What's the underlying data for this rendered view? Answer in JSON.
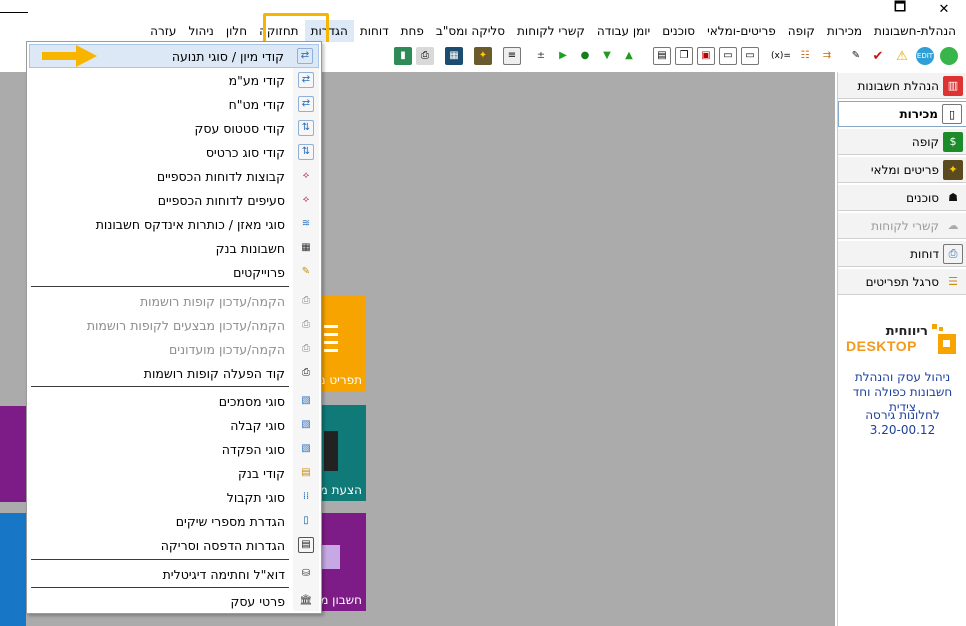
{
  "window": {
    "min_glyph": "🗖",
    "close_glyph": "✕"
  },
  "menubar": {
    "items": [
      {
        "label": "הנהלת-חשבונות"
      },
      {
        "label": "מכירות"
      },
      {
        "label": "קופה"
      },
      {
        "label": "פריטים-ומלאי"
      },
      {
        "label": "סוכנים"
      },
      {
        "label": "יומן עבודה"
      },
      {
        "label": "קשרי לקוחות"
      },
      {
        "label": "סליקה ומס\"ב"
      },
      {
        "label": "פחת"
      },
      {
        "label": "דוחות"
      },
      {
        "label": "הגדרות"
      },
      {
        "label": "תחזוקה"
      },
      {
        "label": "חלון"
      },
      {
        "label": "ניהול"
      },
      {
        "label": "עזרה"
      }
    ],
    "active": "הגדרות"
  },
  "toolbar": {
    "icons": [
      "exit-door-icon",
      "printer-icon",
      "calculator-icon",
      "tools-box-icon",
      "notepad-icon",
      "plus-minus-icon",
      "forward-icon",
      "money-bag-icon",
      "download-green-icon",
      "upload-green-icon",
      "documents-icon",
      "copy-icon",
      "report-icon",
      "card-icon",
      "card2-icon",
      "formula-icon",
      "stack-icon",
      "transfer-icon",
      "edit-pen-icon",
      "check-red-icon",
      "warning-icon",
      "edit-round-icon",
      "green-circle-icon"
    ],
    "formula_text": "(x)="
  },
  "dropdown": {
    "items": [
      {
        "label": "קודי מיון / סוגי תנועה",
        "disabled": false,
        "icon": "sort-codes-icon"
      },
      {
        "label": "קודי מע\"מ",
        "disabled": false,
        "icon": "vat-codes-icon"
      },
      {
        "label": "קודי מט\"ח",
        "disabled": false,
        "icon": "currency-codes-icon"
      },
      {
        "label": "קודי סטטוס עסק",
        "disabled": false,
        "icon": "business-status-icon"
      },
      {
        "label": "קודי סוג כרטיס",
        "disabled": false,
        "icon": "card-type-icon"
      },
      {
        "label": "קבוצות לדוחות הכספיים",
        "disabled": false,
        "icon": "report-groups-icon"
      },
      {
        "label": "סעיפים לדוחות הכספיים",
        "disabled": false,
        "icon": "report-sections-icon"
      },
      {
        "label": "סוגי מאזן / כותרות אינדקס חשבונות",
        "disabled": false,
        "icon": "balance-types-icon"
      },
      {
        "label": "חשבונות בנק",
        "disabled": false,
        "icon": "bank-accounts-icon"
      },
      {
        "label": "פרוייקטים",
        "disabled": false,
        "icon": "projects-icon"
      },
      {
        "label": "הקמה/עדכון קופות רושמות",
        "disabled": true,
        "icon": "cash-register-icon"
      },
      {
        "label": "הקמה/עדכון מבצעים לקופות רושמות",
        "disabled": true,
        "icon": "cash-register-promo-icon"
      },
      {
        "label": "הקמה/עדכון מועדונים",
        "disabled": true,
        "icon": "clubs-icon"
      },
      {
        "label": "קוד הפעלה קופות רושמות",
        "disabled": false,
        "icon": "register-activation-icon"
      },
      {
        "label": "סוגי מסמכים",
        "disabled": false,
        "icon": "document-types-icon"
      },
      {
        "label": "סוגי קבלה",
        "disabled": false,
        "icon": "receipt-types-icon"
      },
      {
        "label": "סוגי הפקדה",
        "disabled": false,
        "icon": "deposit-types-icon"
      },
      {
        "label": "קודי בנק",
        "disabled": false,
        "icon": "bank-codes-icon"
      },
      {
        "label": "סוגי תקבול",
        "disabled": false,
        "icon": "payment-types-icon"
      },
      {
        "label": "הגדרת מספרי שיקים",
        "disabled": false,
        "icon": "check-numbers-icon"
      },
      {
        "label": "הגדרות הדפסה וסריקה",
        "disabled": false,
        "icon": "print-scan-icon"
      },
      {
        "label": "דוא\"ל וחתימה דיגיטלית",
        "disabled": false,
        "icon": "email-signature-icon"
      },
      {
        "label": "פרטי עסק",
        "disabled": false,
        "icon": "business-details-icon"
      }
    ]
  },
  "tiles": [
    {
      "label": "תפריט מ",
      "color": "#f7a400"
    },
    {
      "label": "הצעת מ",
      "color": "#0f7a78"
    },
    {
      "label": "חשבון מ",
      "color": "#7d1c86"
    }
  ],
  "sidebar": {
    "items": [
      {
        "label": "הנהלת חשבונות",
        "state": "normal",
        "icon": "ledger-book-icon"
      },
      {
        "label": "מכירות",
        "state": "selected",
        "icon": "sales-document-icon"
      },
      {
        "label": "קופה",
        "state": "normal",
        "icon": "cash-bag-icon"
      },
      {
        "label": "פריטים ומלאי",
        "state": "normal",
        "icon": "inventory-box-icon"
      },
      {
        "label": "סוכנים",
        "state": "normal",
        "icon": "agent-spy-icon"
      },
      {
        "label": "קשרי לקוחות",
        "state": "disabled",
        "icon": "customer-cloud-icon"
      },
      {
        "label": "דוחות",
        "state": "normal",
        "icon": "reports-printer-icon"
      },
      {
        "label": "סרגל תפריטים",
        "state": "normal",
        "icon": "menu-tree-icon"
      }
    ],
    "brand": {
      "name": "ריווחית",
      "desktop": "DESKTOP"
    },
    "tagline_1": "ניהול עסק והנהלת",
    "tagline_2": "חשבונות כפולה וחד צידית",
    "version_label": "לחלונות גירסה",
    "version": "3.20-00.12"
  }
}
